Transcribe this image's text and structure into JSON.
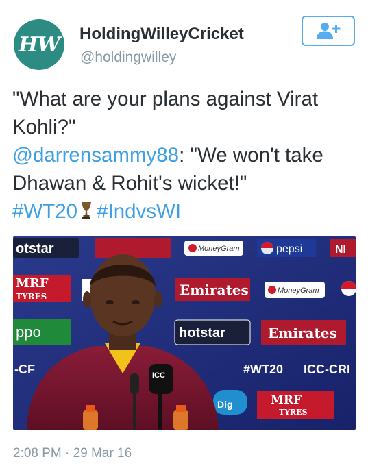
{
  "author": {
    "avatar_initials": "HW",
    "display_name": "HoldingWilleyCricket",
    "handle": "@holdingwilley"
  },
  "follow_button": {
    "icon": "add-user-icon"
  },
  "tweet": {
    "line1": "\"What are your plans against Virat",
    "line2": "Kohli?\"",
    "mention": "@darrensammy88",
    "line3_rest": ": \"We won't take",
    "line4": "Dhawan & Rohit's wicket!\"",
    "hashtag1": "#WT20",
    "hashtag2": "#IndvsWI",
    "trophy_icon": "trophy-icon"
  },
  "media": {
    "sponsor_texts": [
      "otstar",
      "MoneyGram",
      "pepsi",
      "NI",
      "MRF",
      "TYRES",
      "Emirates",
      "MoneyGram",
      "ppo",
      "hotstar",
      "Emirates",
      "-CF",
      "ICC",
      "#WT20",
      "ICC-CRI",
      "MRF",
      "TYRES",
      "Dig"
    ]
  },
  "timestamp": "2:08 PM · 29 Mar 16",
  "colors": {
    "link": "#3ea0e3",
    "avatar_bg": "#2c8c83",
    "muted": "#8899a6",
    "follow_border": "#55acee"
  }
}
